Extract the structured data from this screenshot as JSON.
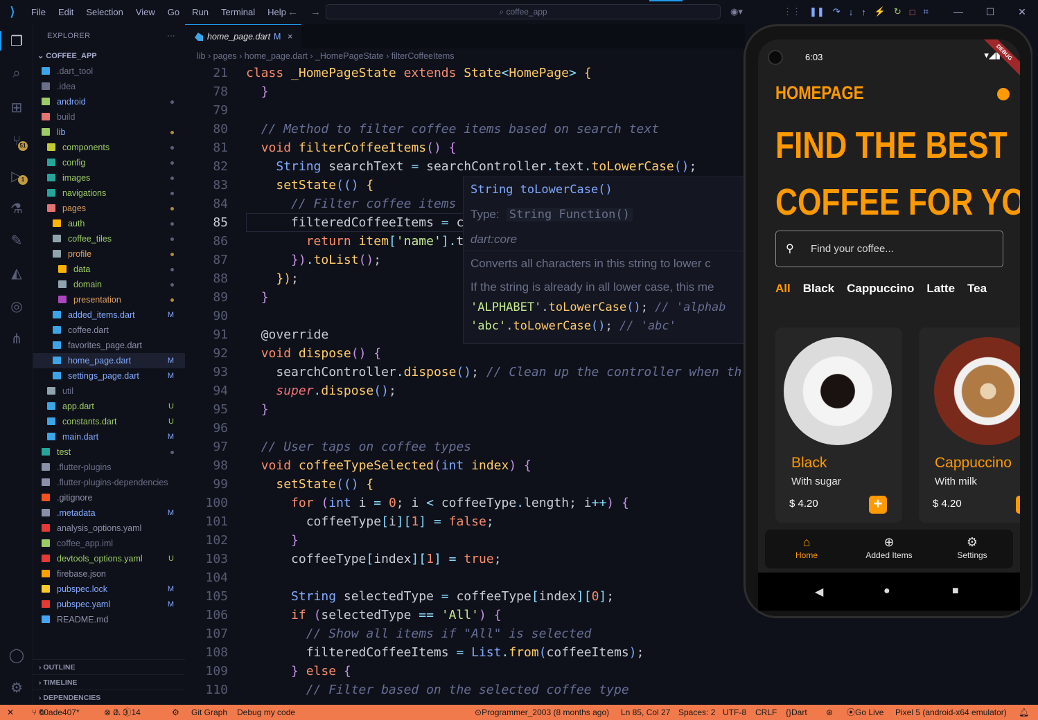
{
  "titlebar": {
    "menu": [
      "File",
      "Edit",
      "Selection",
      "View",
      "Go",
      "Run",
      "Terminal",
      "Help"
    ],
    "search": "coffee_app"
  },
  "explorer": {
    "title": "EXPLORER",
    "project": "COFFEE_APP",
    "items": [
      {
        "label": ".dart_tool",
        "indent": 0,
        "color": "#3ba5e8",
        "text": "#6a7089",
        "st": ""
      },
      {
        "label": ".idea",
        "indent": 0,
        "color": "#6a7089",
        "text": "#6a7089",
        "st": ""
      },
      {
        "label": "android",
        "indent": 0,
        "color": "#9ccc65",
        "text": "#82aaff",
        "st": "dot"
      },
      {
        "label": "build",
        "indent": 0,
        "color": "#e57373",
        "text": "#6a7089",
        "st": ""
      },
      {
        "label": "lib",
        "indent": 0,
        "color": "#9ccc65",
        "text": "#82aaff",
        "st": "odot"
      },
      {
        "label": "components",
        "indent": 1,
        "color": "#c0ca33",
        "text": "#9ccc65",
        "st": "dot"
      },
      {
        "label": "config",
        "indent": 1,
        "color": "#26a69a",
        "text": "#9ccc65",
        "st": "dot"
      },
      {
        "label": "images",
        "indent": 1,
        "color": "#26a69a",
        "text": "#9ccc65",
        "st": "dot"
      },
      {
        "label": "navigations",
        "indent": 1,
        "color": "#26a69a",
        "text": "#9ccc65",
        "st": "dot"
      },
      {
        "label": "pages",
        "indent": 1,
        "color": "#e57373",
        "text": "#e0a060",
        "st": "odot"
      },
      {
        "label": "auth",
        "indent": 2,
        "color": "#ffb300",
        "text": "#9ccc65",
        "st": "dot"
      },
      {
        "label": "coffee_tiles",
        "indent": 2,
        "color": "#90a4ae",
        "text": "#9ccc65",
        "st": "dot"
      },
      {
        "label": "profile",
        "indent": 2,
        "color": "#90a4ae",
        "text": "#e0a060",
        "st": "odot"
      },
      {
        "label": "data",
        "indent": 3,
        "color": "#ffb300",
        "text": "#9ccc65",
        "st": "dot"
      },
      {
        "label": "domain",
        "indent": 3,
        "color": "#90a4ae",
        "text": "#9ccc65",
        "st": "dot"
      },
      {
        "label": "presentation",
        "indent": 3,
        "color": "#ab47bc",
        "text": "#e0a060",
        "st": "odot"
      },
      {
        "label": "added_items.dart",
        "indent": 2,
        "color": "#3ba5e8",
        "text": "#82aaff",
        "st": "M"
      },
      {
        "label": "coffee.dart",
        "indent": 2,
        "color": "#3ba5e8",
        "text": "#8b90a8",
        "st": ""
      },
      {
        "label": "favorites_page.dart",
        "indent": 2,
        "color": "#3ba5e8",
        "text": "#8b90a8",
        "st": ""
      },
      {
        "label": "home_page.dart",
        "indent": 2,
        "color": "#3ba5e8",
        "text": "#82aaff",
        "st": "M",
        "sel": true
      },
      {
        "label": "settings_page.dart",
        "indent": 2,
        "color": "#3ba5e8",
        "text": "#82aaff",
        "st": "M"
      },
      {
        "label": "util",
        "indent": 1,
        "color": "#90a4ae",
        "text": "#6a7089",
        "st": ""
      },
      {
        "label": "app.dart",
        "indent": 1,
        "color": "#3ba5e8",
        "text": "#9ccc65",
        "st": "U"
      },
      {
        "label": "constants.dart",
        "indent": 1,
        "color": "#3ba5e8",
        "text": "#9ccc65",
        "st": "U"
      },
      {
        "label": "main.dart",
        "indent": 1,
        "color": "#3ba5e8",
        "text": "#82aaff",
        "st": "M"
      },
      {
        "label": "test",
        "indent": 0,
        "color": "#26a69a",
        "text": "#9ccc65",
        "st": "dot"
      },
      {
        "label": ".flutter-plugins",
        "indent": 0,
        "color": "#8b90a8",
        "text": "#6a7089",
        "st": ""
      },
      {
        "label": ".flutter-plugins-dependencies",
        "indent": 0,
        "color": "#8b90a8",
        "text": "#6a7089",
        "st": ""
      },
      {
        "label": ".gitignore",
        "indent": 0,
        "color": "#f4511e",
        "text": "#8b90a8",
        "st": ""
      },
      {
        "label": ".metadata",
        "indent": 0,
        "color": "#8b90a8",
        "text": "#82aaff",
        "st": "M"
      },
      {
        "label": "analysis_options.yaml",
        "indent": 0,
        "color": "#e53935",
        "text": "#8b90a8",
        "st": ""
      },
      {
        "label": "coffee_app.iml",
        "indent": 0,
        "color": "#9ccc65",
        "text": "#6a7089",
        "st": ""
      },
      {
        "label": "devtools_options.yaml",
        "indent": 0,
        "color": "#e53935",
        "text": "#9ccc65",
        "st": "U"
      },
      {
        "label": "firebase.json",
        "indent": 0,
        "color": "#ffa000",
        "text": "#8b90a8",
        "st": ""
      },
      {
        "label": "pubspec.lock",
        "indent": 0,
        "color": "#ffca28",
        "text": "#82aaff",
        "st": "M"
      },
      {
        "label": "pubspec.yaml",
        "indent": 0,
        "color": "#e53935",
        "text": "#82aaff",
        "st": "M"
      },
      {
        "label": "README.md",
        "indent": 0,
        "color": "#42a5f5",
        "text": "#8b90a8",
        "st": ""
      }
    ],
    "panels": [
      "OUTLINE",
      "TIMELINE",
      "DEPENDENCIES"
    ]
  },
  "tab": {
    "label": "home_page.dart",
    "status": "M"
  },
  "breadcrumb": [
    "lib",
    "pages",
    "home_page.dart",
    "_HomePageState",
    "filterCoffeeItems"
  ],
  "badges": {
    "scm": "51",
    "debug": "1"
  },
  "code": [
    {
      "n": "21",
      "h": "<span class='k'>class</span> <span class='yw'>_HomePageState</span> <span class='k'>extends</span> <span class='yw'>State</span><span class='op'>&lt;</span><span class='yw'>HomePage</span><span class='op'>&gt;</span> <span class='fn'>{</span>"
    },
    {
      "n": "78",
      "h": "  <span class='kw'>}</span>"
    },
    {
      "n": "79",
      "h": ""
    },
    {
      "n": "80",
      "h": "  <span class='cm'>// Method to filter coffee items based on search text</span>"
    },
    {
      "n": "81",
      "h": "  <span class='k'>void</span> <span class='fn'>filterCoffeeItems</span><span class='kw'>()</span> <span class='kw'>{</span>"
    },
    {
      "n": "82",
      "h": "    <span class='ty'>String</span> searchText <span class='op'>=</span> searchController<span class='op'>.</span>text<span class='op'>.</span><span class='fn'>toLowerCase</span><span class='bl'>()</span>;"
    },
    {
      "n": "83",
      "h": "    <span class='fn'>setState</span><span class='bl'>(()</span> <span class='fn'>{</span>"
    },
    {
      "n": "84",
      "h": "      <span class='cm'>// Filter coffee items</span>"
    },
    {
      "n": "85",
      "h": "      filteredCoffeeItems <span class='op'>=</span> c",
      "cur": true
    },
    {
      "n": "86",
      "h": "        <span class='k'>return</span> <span class='fn'>item</span><span class='op'>[</span><span class='str'>'name'</span><span class='op'>].</span>t"
    },
    {
      "n": "87",
      "h": "      <span class='kw'>})</span><span class='op'>.</span><span class='fn'>toList</span><span class='kw'>()</span>;"
    },
    {
      "n": "88",
      "h": "    <span class='fn'>})</span>;"
    },
    {
      "n": "89",
      "h": "  <span class='kw'>}</span>"
    },
    {
      "n": "90",
      "h": ""
    },
    {
      "n": "91",
      "h": "  @override"
    },
    {
      "n": "92",
      "h": "  <span class='k'>void</span> <span class='fn'>dispose</span><span class='kw'>()</span> <span class='kw'>{</span>"
    },
    {
      "n": "93",
      "h": "    searchController<span class='op'>.</span><span class='fn'>dispose</span><span class='bl'>()</span>; <span class='cm'>// Clean up the controller when th</span>"
    },
    {
      "n": "94",
      "h": "    <span class='mv' style='font-style:italic'>super</span><span class='op'>.</span><span class='fn'>dispose</span><span class='bl'>()</span>;"
    },
    {
      "n": "95",
      "h": "  <span class='kw'>}</span>"
    },
    {
      "n": "96",
      "h": ""
    },
    {
      "n": "97",
      "h": "  <span class='cm'>// User taps on coffee types</span>"
    },
    {
      "n": "98",
      "h": "  <span class='k'>void</span> <span class='fn'>coffeeTypeSelected</span><span class='kw'>(</span><span class='ty'>int</span> <span class='yw'>index</span><span class='kw'>)</span> <span class='kw'>{</span>"
    },
    {
      "n": "99",
      "h": "    <span class='fn'>setState</span><span class='bl'>(()</span> <span class='fn'>{</span>"
    },
    {
      "n": "100",
      "h": "      <span class='k'>for</span> <span class='kw'>(</span><span class='ty'>int</span> i <span class='op'>=</span> <span class='num'>0</span>; i <span class='op'>&lt;</span> coffeeType<span class='op'>.</span>length; i<span class='op'>++</span><span class='kw'>)</span> <span class='kw'>{</span>"
    },
    {
      "n": "101",
      "h": "        coffeeType<span class='op'>[</span>i<span class='op'>][</span><span class='num'>1</span><span class='op'>]</span> <span class='op'>=</span> <span class='num'>false</span>;"
    },
    {
      "n": "102",
      "h": "      <span class='kw'>}</span>"
    },
    {
      "n": "103",
      "h": "      coffeeType<span class='op'>[</span>index<span class='op'>][</span><span class='num'>1</span><span class='op'>]</span> <span class='op'>=</span> <span class='num'>true</span>;"
    },
    {
      "n": "104",
      "h": ""
    },
    {
      "n": "105",
      "h": "      <span class='ty'>String</span> selectedType <span class='op'>=</span> coffeeType<span class='op'>[</span>index<span class='op'>][</span><span class='num'>0</span><span class='op'>]</span>;"
    },
    {
      "n": "106",
      "h": "      <span class='k'>if</span> <span class='kw'>(</span>selectedType <span class='op'>==</span> <span class='str'>'All'</span><span class='kw'>)</span> <span class='kw'>{</span>"
    },
    {
      "n": "107",
      "h": "        <span class='cm'>// Show all items if \"All\" is selected</span>"
    },
    {
      "n": "108",
      "h": "        filteredCoffeeItems <span class='op'>=</span> <span class='ty'>List</span><span class='op'>.</span><span class='fn'>from</span><span class='bl'>(</span>coffeeItems<span class='bl'>)</span>;"
    },
    {
      "n": "109",
      "h": "      <span class='kw'>}</span> <span class='k'>else</span> <span class='kw'>{</span>"
    },
    {
      "n": "110",
      "h": "        <span class='cm'>// Filter based on the selected coffee type</span>"
    }
  ],
  "hover": {
    "sig": "String toLowerCase()",
    "type_label": "Type:",
    "type_val": "String Function()",
    "lib": "dart:core",
    "doc1": "Converts all characters in this string to lower c",
    "doc2": "If the string is already in all lower case, this me",
    "ex1a": "'ALPHABET'",
    "ex1b": "toLowerCase",
    "ex1c": "// 'alphab",
    "ex2a": "'abc'",
    "ex2c": "// 'abc'"
  },
  "phone": {
    "time": "6:03",
    "debug": "DEBUG",
    "title": "HOMEPAGE",
    "headline1": "FIND THE BEST",
    "headline2": "COFFEE FOR YOU",
    "search_placeholder": "Find your coffee...",
    "types": [
      "All",
      "Black",
      "Cappuccino",
      "Latte",
      "Tea"
    ],
    "cards": [
      {
        "name": "Black",
        "sub": "With sugar",
        "price": "$ 4.20"
      },
      {
        "name": "Cappuccino",
        "sub": "With milk",
        "price": "$ 4.20"
      }
    ],
    "nav": [
      "Home",
      "Added Items",
      "Settings"
    ],
    "accent": "#ff9900"
  },
  "status": {
    "branch": "00ade407*",
    "errors": "0",
    "warnings": "3",
    "info": "14",
    "gitgraph": "Git Graph",
    "debug": "Debug my code",
    "blame": "Programmer_2003 (8 months ago)",
    "pos": "Ln 85, Col 27",
    "spaces": "Spaces: 2",
    "enc": "UTF-8",
    "eol": "CRLF",
    "lang": "Dart",
    "golive": "Go Live",
    "device": "Pixel 5 (android-x64 emulator)"
  }
}
